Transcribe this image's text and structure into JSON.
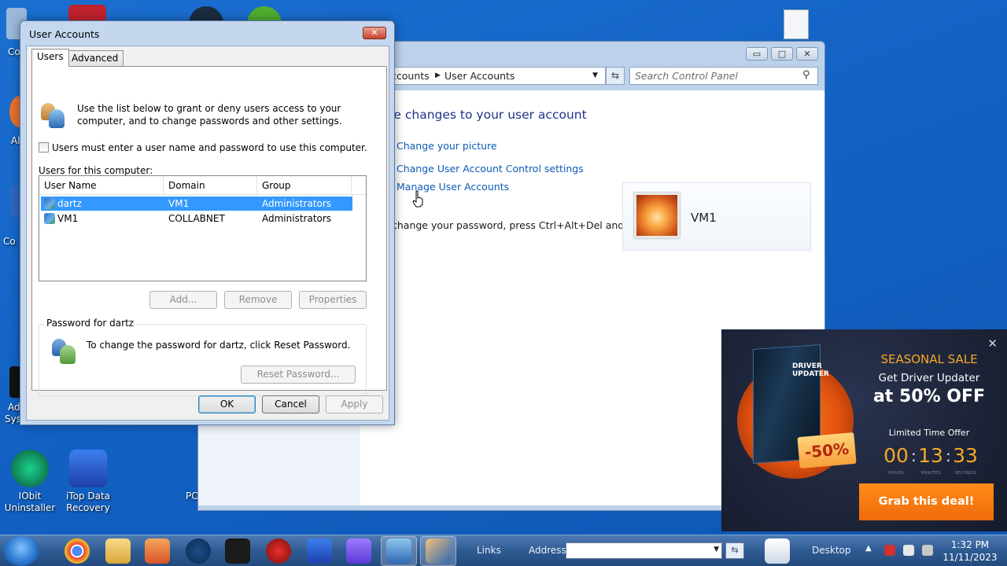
{
  "desktop": {
    "icons": [
      {
        "label_line1": "IObit",
        "label_line2": "Uninstaller",
        "color": "#0f7a52"
      },
      {
        "label_line1": "iTop Data",
        "label_line2": "Recovery",
        "color": "#2d5fd6"
      }
    ],
    "partial_labels": [
      "Co",
      "Al",
      "Co",
      "Ad",
      "Sys",
      "PC"
    ]
  },
  "control_panel": {
    "breadcrumb_partial": "ccounts",
    "breadcrumb_current": "User Accounts",
    "search_placeholder": "Search Control Panel",
    "heading": "ke changes to your user account",
    "links": [
      "Change your picture",
      "Change User Account Control settings",
      "Manage User Accounts"
    ],
    "note": "change your password, press Ctrl+Alt+Del and select Change a password.",
    "account_name": "VM1"
  },
  "dialog": {
    "title": "User Accounts",
    "tabs": [
      "Users",
      "Advanced"
    ],
    "intro": "Use the list below to grant or deny users access to your computer, and to change passwords and other settings.",
    "checkbox_label": "Users must enter a user name and password to use this computer.",
    "users_label": "Users for this computer:",
    "columns": [
      "User Name",
      "Domain",
      "Group"
    ],
    "rows": [
      {
        "name": "dartz",
        "domain": "VM1",
        "group": "Administrators"
      },
      {
        "name": "VM1",
        "domain": "COLLABNET",
        "group": "Administrators"
      }
    ],
    "buttons": {
      "add": "Add...",
      "remove": "Remove",
      "properties": "Properties",
      "reset": "Reset Password...",
      "ok": "OK",
      "cancel": "Cancel",
      "apply": "Apply"
    },
    "password_group_title": "Password for dartz",
    "password_text": "To change the password for dartz, click Reset Password."
  },
  "ad": {
    "box_title": "DRIVER UPDATER",
    "badge": "-50%",
    "seasonal": "SEASONAL SALE",
    "get": "Get Driver Updater",
    "offer": "at 50% OFF",
    "limited": "Limited Time Offer",
    "timer": {
      "hours": "00",
      "minutes": "13",
      "seconds": "33"
    },
    "timer_labels": {
      "hours": "HOURS",
      "minutes": "MINUTES",
      "seconds": "SECONDS"
    },
    "cta": "Grab this deal!",
    "accent_color": "#f7a827"
  },
  "taskbar": {
    "links_label": "Links",
    "address_label": "Address",
    "desktop_label": "Desktop",
    "time": "1:32 PM",
    "date": "11/11/2023"
  }
}
